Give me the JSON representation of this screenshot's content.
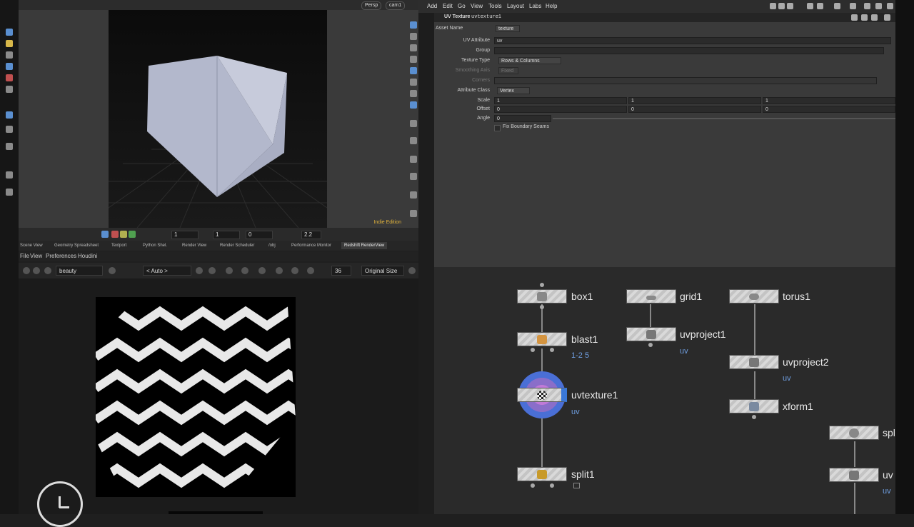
{
  "viewport": {
    "persp": "Persp",
    "cam": "cam1",
    "edition": "Indie Edition",
    "bottom_fields": [
      "1",
      "1",
      "0",
      "2.2"
    ]
  },
  "tabs": [
    "Scene View",
    "Geometry Spreadsheet",
    "Textport",
    "Python Shel.",
    "Render View",
    "Render Scheduler",
    "/obj",
    "Performance Monitor",
    "Redshift RenderView"
  ],
  "renderview": {
    "menu": [
      "File",
      "View",
      "Preferences",
      "Houdini"
    ],
    "aov": "beauty",
    "camera": "< Auto >",
    "zoom": "36 %",
    "size": "Original Size"
  },
  "menubar": [
    "Add",
    "Edit",
    "Go",
    "View",
    "Tools",
    "Layout",
    "Labs",
    "Help"
  ],
  "params": {
    "header_type": "UV Texture",
    "header_name": "uvtexture1",
    "asset_name_label": "Asset Name",
    "asset_name_value": "texture",
    "uv_attribute_label": "UV Attribute",
    "uv_attribute_value": "uv",
    "group_label": "Group",
    "texture_type_label": "Texture Type",
    "texture_type_value": "Rows & Columns",
    "smoothing_label": "Smoothing Axis",
    "smoothing_value": "Fixed",
    "corners_label": "Corners",
    "attr_class_label": "Attribute Class",
    "attr_class_value": "Vertex",
    "scale_label": "Scale",
    "scale_values": [
      "1",
      "1",
      "1"
    ],
    "offset_label": "Offset",
    "offset_values": [
      "0",
      "0",
      "0"
    ],
    "angle_label": "Angle",
    "angle_value": "0",
    "fix_seams_label": "Fix Boundary Seams"
  },
  "network": {
    "box1": "box1",
    "blast1": "blast1",
    "blast1_sub": "1-2 5",
    "uvtexture1": "uvtexture1",
    "uvtexture1_sub": "uv",
    "split1": "split1",
    "grid1": "grid1",
    "uvproject1": "uvproject1",
    "uvproject1_sub": "uv",
    "torus1": "torus1",
    "uvproject2": "uvproject2",
    "uvproject2_sub": "uv",
    "xform1": "xform1",
    "partial1": "spl",
    "partial2": "uv",
    "partial2_sub": "uv"
  },
  "colors": {
    "accent_selected": "#4a6fd6",
    "node_sub_text": "#6f9ee0",
    "edition_text": "#e0b23c"
  }
}
